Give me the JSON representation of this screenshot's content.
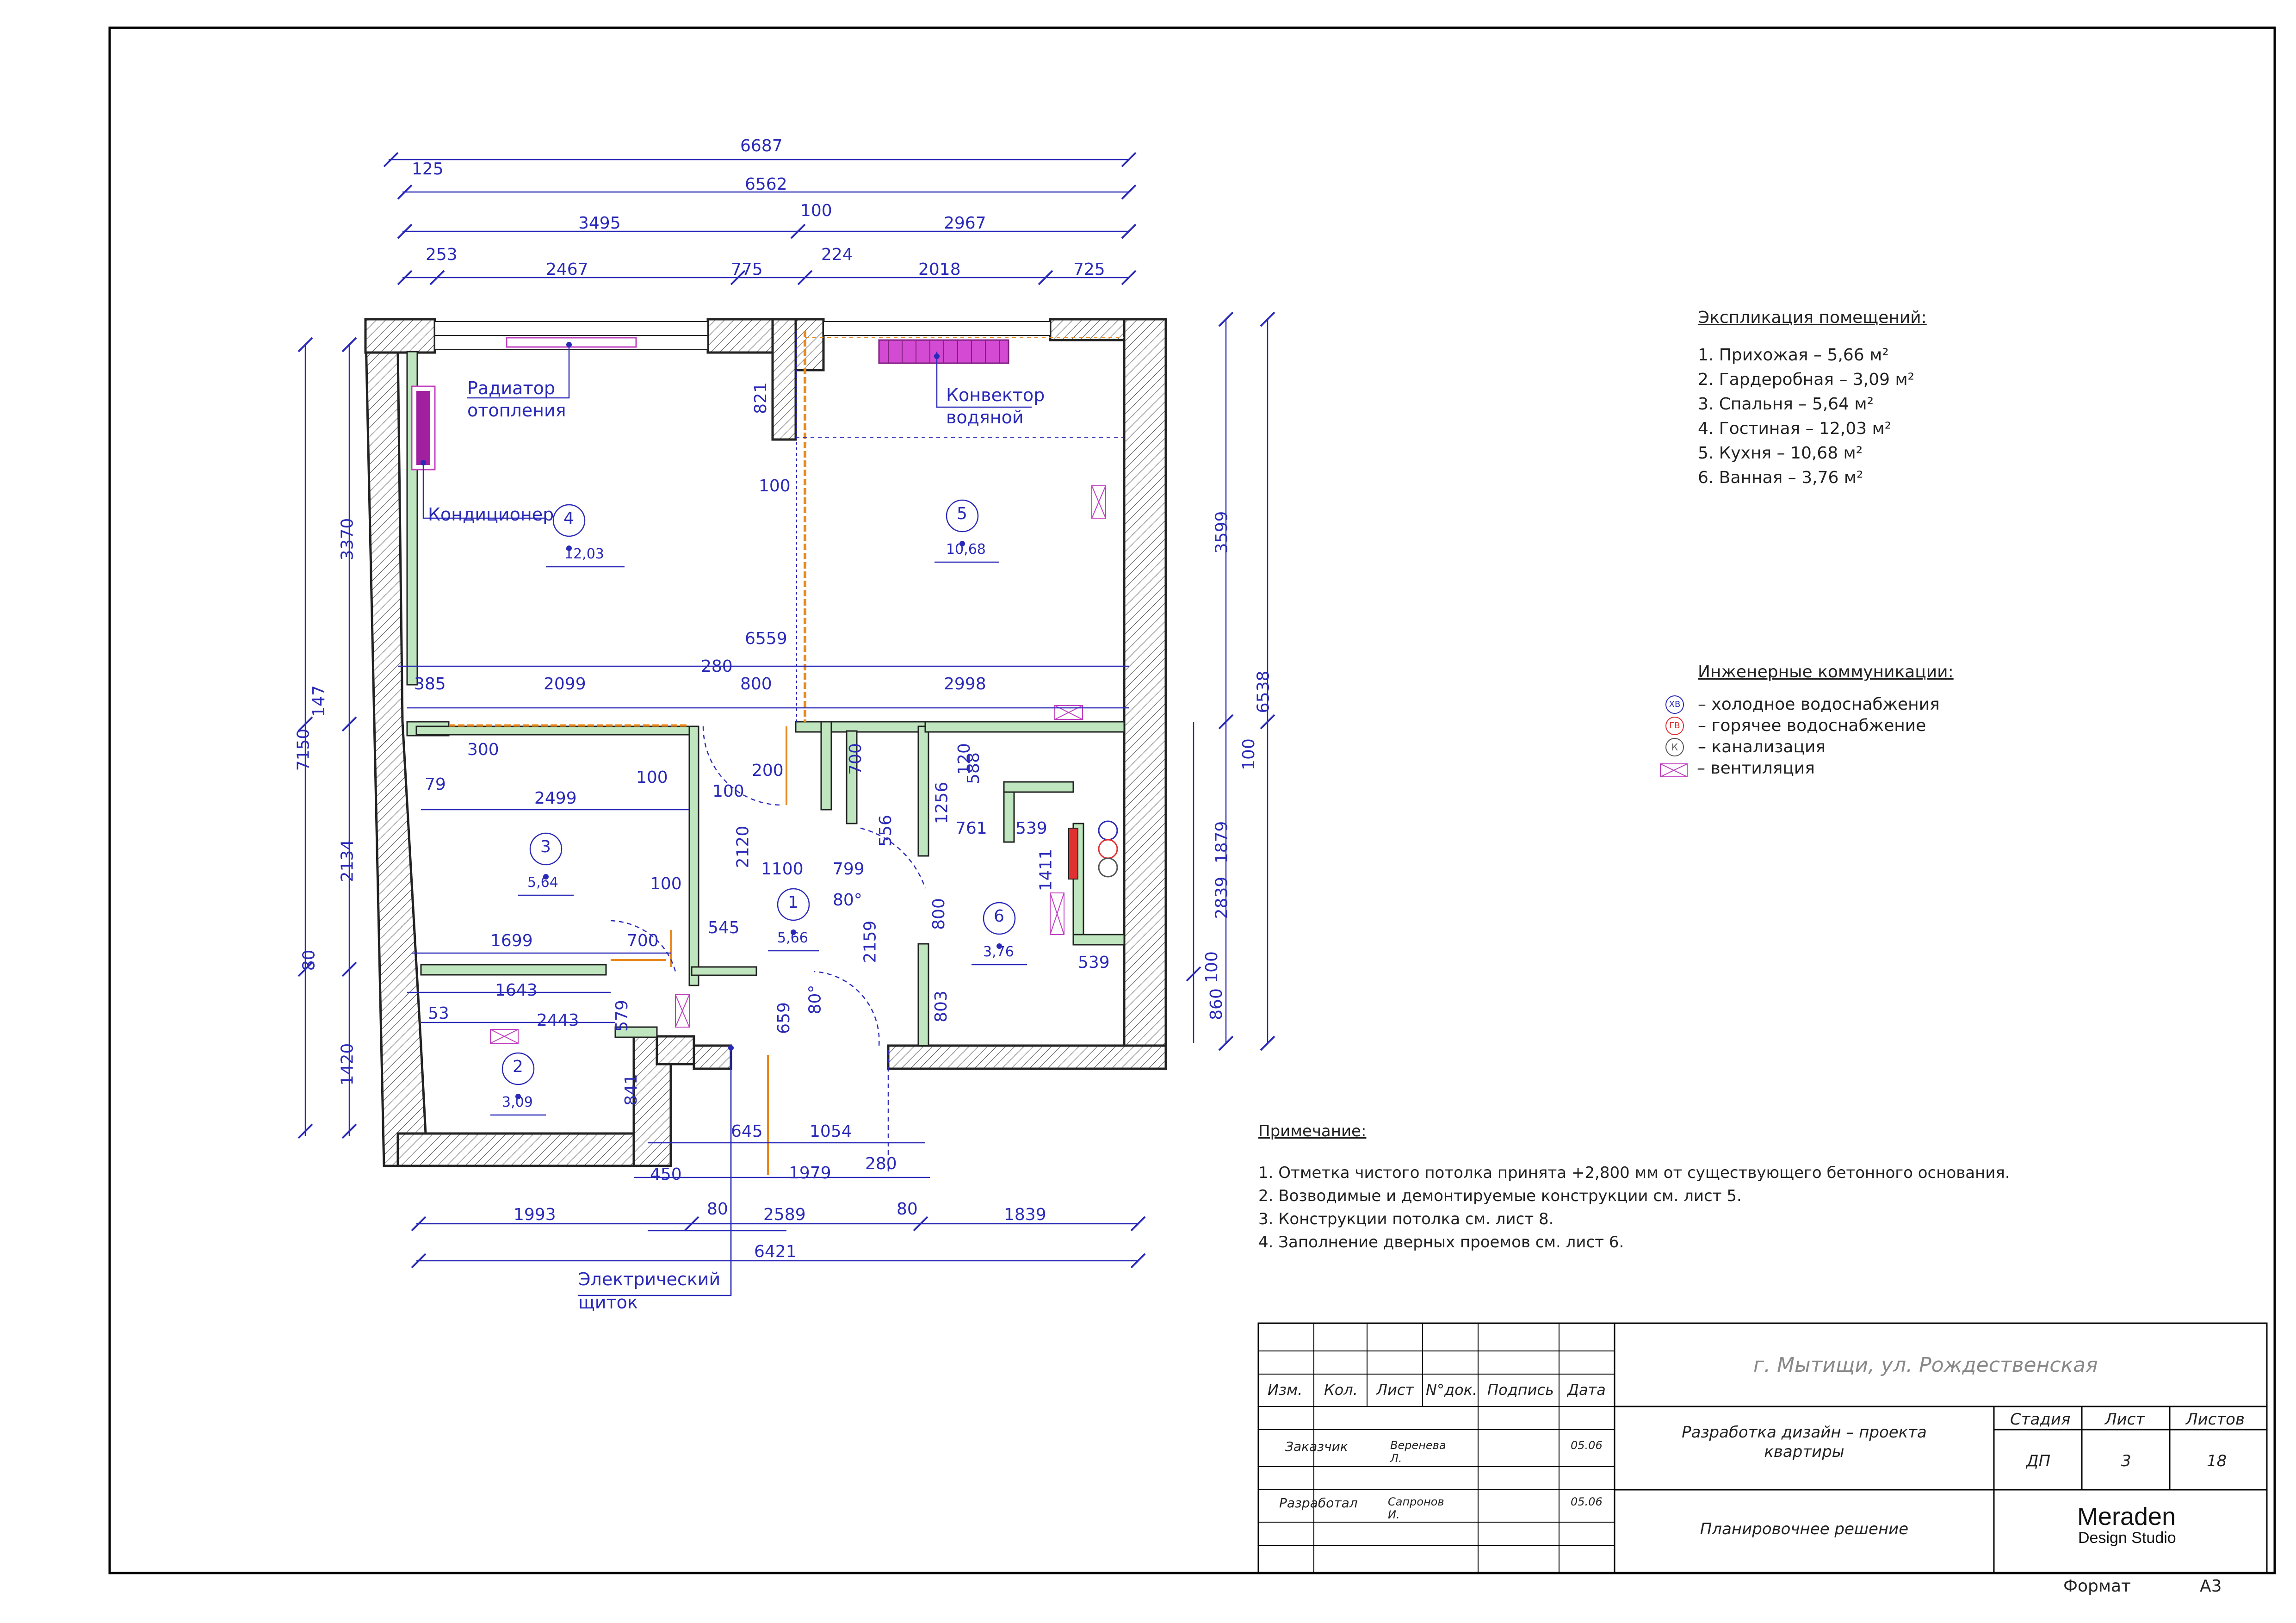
{
  "explication": {
    "title": "Экспликация помещений:",
    "items": [
      "1. Прихожая – 5,66 м²",
      "2. Гардеробная – 3,09 м²",
      "3. Спальня – 5,64 м²",
      "4. Гостиная – 12,03 м²",
      "5. Кухня – 10,68 м²",
      "6. Ванная – 3,76 м²"
    ]
  },
  "utilities": {
    "title": "Инженерные коммуникации:",
    "items": [
      {
        "symbol": "ХВ",
        "label": "– холодное водоснабжения",
        "color": "#2a2ab8"
      },
      {
        "symbol": "ГВ",
        "label": "– горячее водоснабжение",
        "color": "#e03030"
      },
      {
        "symbol": "К",
        "label": "– канализация",
        "color": "#555555"
      },
      {
        "symbol": "vent-icon",
        "label": "– вентиляция",
        "color": "#c040c0"
      }
    ]
  },
  "notes": {
    "title": "Примечание:",
    "items": [
      "1. Отметка чистого потолка принята +2,800 мм от существующего бетонного основания.",
      "2. Возводимые и демонтируемые конструкции см. лист 5.",
      "3. Конструкции потолка см. лист 8.",
      "4. Заполнение дверных проемов см. лист 6."
    ]
  },
  "rooms": [
    {
      "num": "1",
      "area": "5,66"
    },
    {
      "num": "2",
      "area": "3,09"
    },
    {
      "num": "3",
      "area": "5,64"
    },
    {
      "num": "4",
      "area": "12,03"
    },
    {
      "num": "5",
      "area": "10,68"
    },
    {
      "num": "6",
      "area": "3,76"
    }
  ],
  "labels": {
    "radiator": [
      "Радиатор",
      "отопления"
    ],
    "convector": [
      "Конвектор",
      "водяной"
    ],
    "conditioner": "Кондиционер",
    "panel": [
      "Электрический",
      "щиток"
    ]
  },
  "title_block": {
    "address": "г. Мытищи, ул. Рождественская",
    "headers": [
      "Изм.",
      "Кол.",
      "Лист",
      "N°док.",
      "Подпись",
      "Дата"
    ],
    "customer_role": "Заказчик",
    "customer_name": "Веренева Л.",
    "customer_date": "05.06",
    "developer_role": "Разработал",
    "developer_name": "Сапронов И.",
    "developer_date": "05.06",
    "project": [
      "Разработка дизайн – проекта",
      "квартиры"
    ],
    "stage_header": "Стадия",
    "sheet_header": "Лист",
    "sheets_header": "Листов",
    "stage": "ДП",
    "sheet": "3",
    "sheets": "18",
    "drawing": "Планировочнее решение",
    "studio": "Meraden",
    "studio_sub": "Design Studio",
    "format_label": "Формат",
    "format_value": "А3"
  },
  "dimensions": {
    "top": [
      "6687",
      "125",
      "6562",
      "3495",
      "100",
      "2967",
      "253",
      "2467",
      "775",
      "224",
      "2018",
      "725"
    ],
    "inner": [
      "821",
      "100",
      "6559",
      "385",
      "2099",
      "280",
      "800",
      "2998",
      "147",
      "300",
      "100",
      "200",
      "79",
      "2499",
      "100",
      "700",
      "120",
      "588",
      "1256",
      "761",
      "539",
      "556",
      "2120",
      "1100",
      "799",
      "80°",
      "100",
      "1411",
      "545",
      "800",
      "2159",
      "1699",
      "700",
      "539",
      "1643",
      "53",
      "2443",
      "579",
      "659",
      "80°",
      "803",
      "841"
    ],
    "left": [
      "7150",
      "3370",
      "2134",
      "80",
      "1420"
    ],
    "right": [
      "6538",
      "3599",
      "100",
      "1879",
      "2839",
      "100",
      "860"
    ],
    "bottom": [
      "645",
      "1054",
      "450",
      "1979",
      "280",
      "80",
      "80",
      "1993",
      "2589",
      "1839",
      "6421"
    ]
  }
}
